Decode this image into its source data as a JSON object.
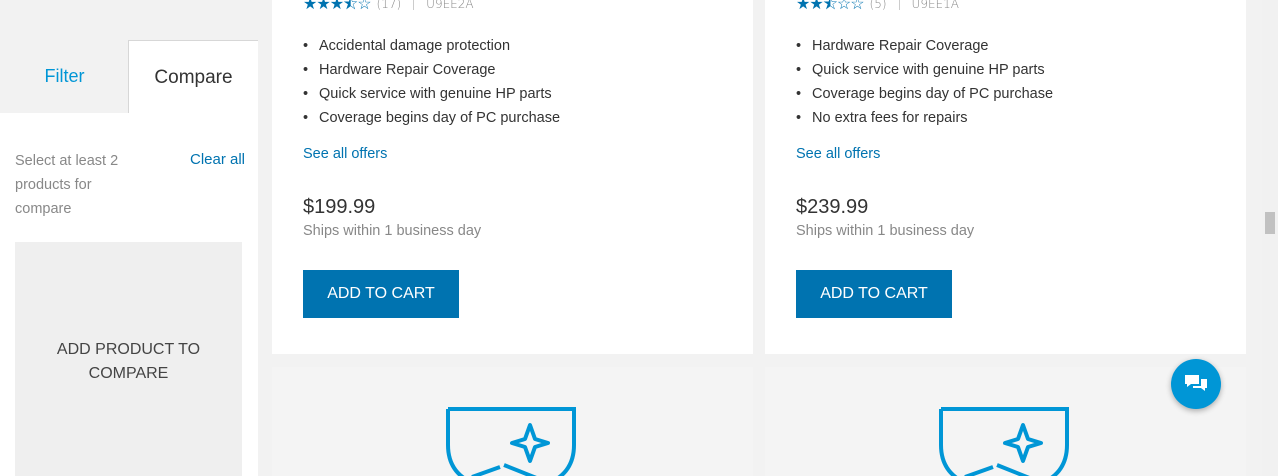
{
  "sidebar": {
    "tabs": [
      {
        "label": "Filter"
      },
      {
        "label": "Compare"
      }
    ],
    "compare_hint": "Select at least 2 products for compare",
    "clear_all": "Clear all",
    "compare_box": "ADD PRODUCT TO COMPARE"
  },
  "products": [
    {
      "rating": 3.5,
      "review_count": "(17)",
      "sku": "U9EE2A",
      "features": [
        "Accidental damage protection",
        "Hardware Repair Coverage",
        "Quick service with genuine HP parts",
        "Coverage begins day of PC purchase"
      ],
      "see_offers": "See all offers",
      "price": "$199.99",
      "ships": "Ships within 1 business day",
      "add_to_cart": "ADD TO CART"
    },
    {
      "rating": 2.5,
      "review_count": "(5)",
      "sku": "U9EE1A",
      "features": [
        "Hardware Repair Coverage",
        "Quick service with genuine HP parts",
        "Coverage begins day of PC purchase",
        "No extra fees for repairs"
      ],
      "see_offers": "See all offers",
      "price": "$239.99",
      "ships": "Ships within 1 business day",
      "add_to_cart": "ADD TO CART"
    }
  ],
  "icons": {
    "care_pack": "care-pack-shield-icon",
    "chat": "chat-icon"
  },
  "colors": {
    "accent": "#0096d6",
    "button": "#0073b0"
  }
}
